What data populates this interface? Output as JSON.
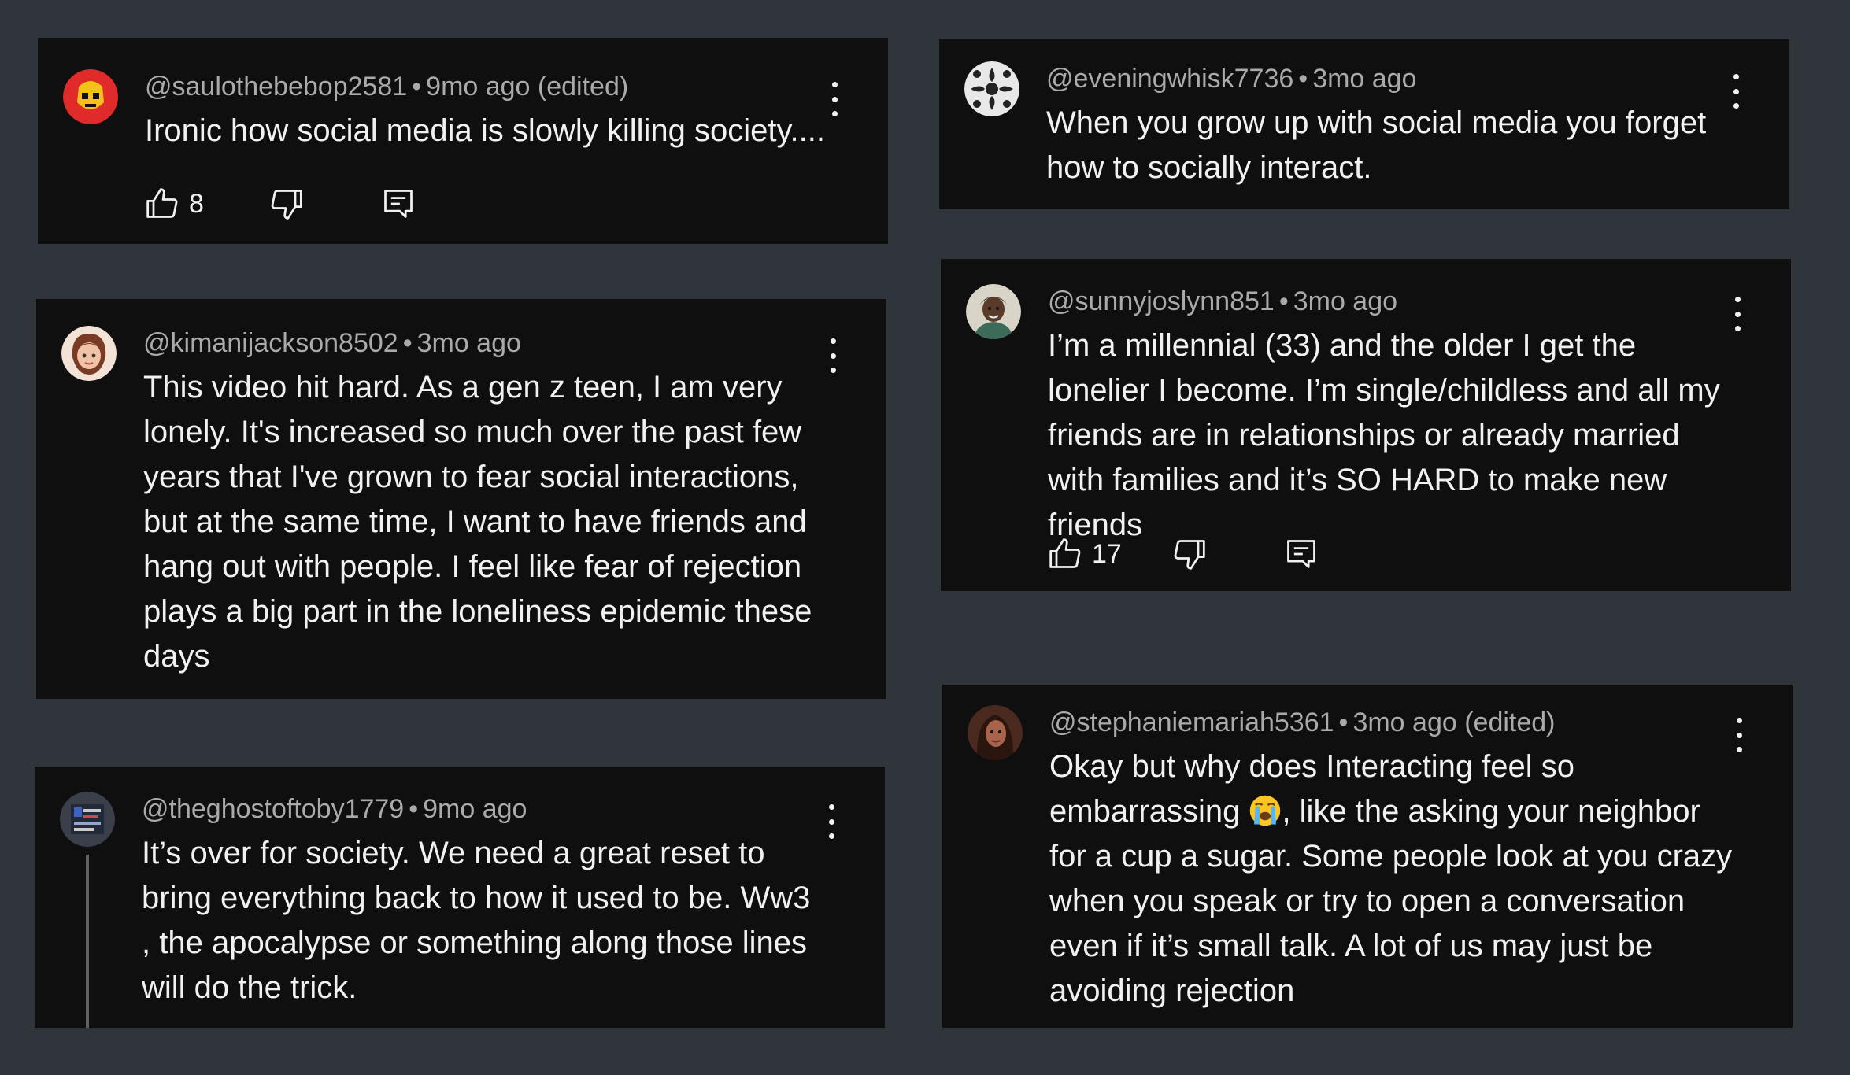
{
  "comments": [
    {
      "handle": "@saulothebebop2581",
      "time": "9mo ago (edited)",
      "text": "Ironic how social media is slowly killing society....",
      "likes": "8",
      "avatar_icon": "yellow-mask-avatar-icon",
      "avatar_color": "#e12a2a"
    },
    {
      "handle": "@kimanijackson8502",
      "time": "3mo ago",
      "text": "This video hit hard. As a gen z teen, I am very lonely. It's increased so much over the past few years that I've grown to fear social interactions, but at the same time, I want to have friends and hang out with people. I feel like fear of rejection plays a big part in the loneliness epidemic these days",
      "avatar_icon": "cartoon-girl-avatar-icon"
    },
    {
      "handle": "@theghostoftoby1779",
      "time": "9mo ago",
      "text": "It’s over for society. We need a great reset to bring everything back to how it used to be. Ww3 , the apocalypse or something along those lines will do the trick.",
      "avatar_icon": "poster-avatar-icon"
    },
    {
      "handle": "@eveningwhisk7736",
      "time": "3mo ago",
      "text": "When you grow up with social media you forget how to socially interact.",
      "avatar_icon": "damask-pattern-avatar-icon"
    },
    {
      "handle": "@sunnyjoslynn851",
      "time": "3mo ago",
      "text": "I’m a millennial (33) and the older I get the lonelier I become. I’m single/childless and all my friends are in relationships or already married with families and it’s SO HARD to make new friends",
      "likes": "17",
      "avatar_icon": "person-photo-avatar-icon"
    },
    {
      "handle": "@stephaniemariah5361",
      "time": "3mo ago (edited)",
      "text_before_emoji": "Okay but why does Interacting feel so embarrassing ",
      "emoji": "loudly-crying-face-emoji",
      "text_after_emoji": ", like the asking your neighbor for a cup a sugar. Some people look at you crazy when you speak or try to open a conversation even if it’s small talk. A lot of us may just be avoiding rejection",
      "avatar_icon": "woman-photo-avatar-icon"
    }
  ],
  "separator": "•",
  "icons": {
    "like": "thumbs-up-icon",
    "dislike": "thumbs-down-icon",
    "reply": "reply-comment-icon",
    "menu": "more-vertical-icon"
  },
  "colors": {
    "page_background": "#30353b",
    "card_background": "#0f0f0f",
    "meta_text": "#aaaaaa",
    "body_text": "#f1f1f1"
  }
}
